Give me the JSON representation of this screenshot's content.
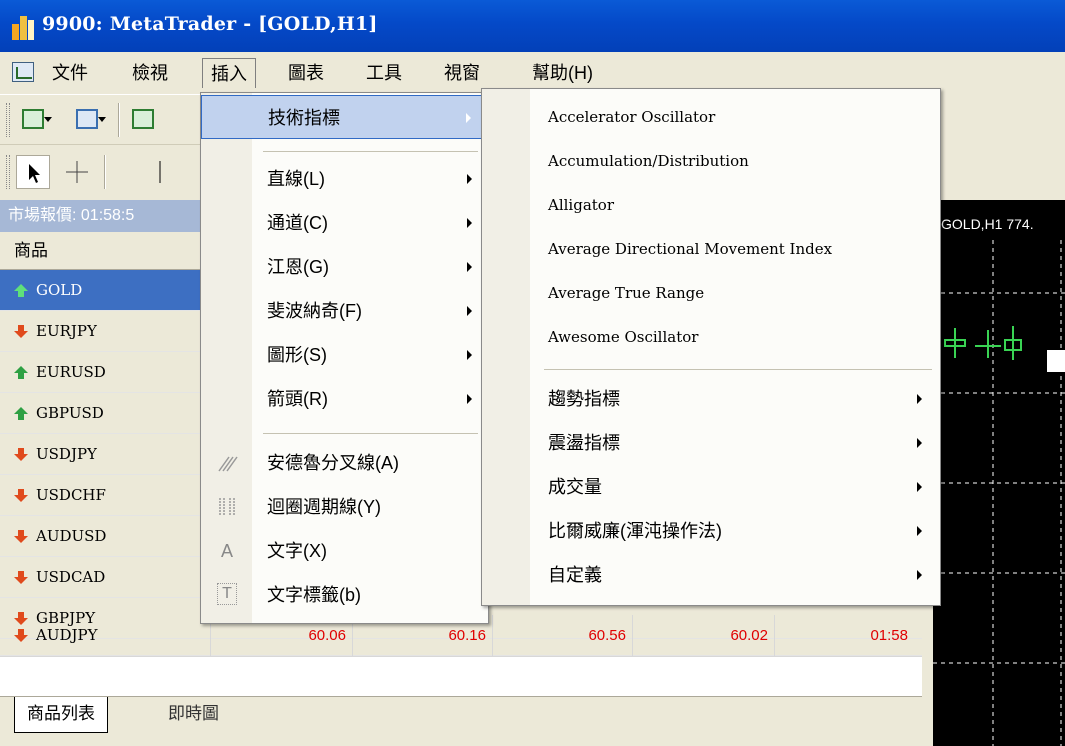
{
  "window": {
    "title": "9900: MetaTrader - [GOLD,H1]"
  },
  "menubar": {
    "items": [
      "文件",
      "檢視",
      "插入",
      "圖表",
      "工具",
      "視窗",
      "幫助(H)"
    ]
  },
  "market_watch": {
    "header": "市場報價: 01:58:5",
    "column_header": "商品",
    "rows": [
      {
        "symbol": "GOLD",
        "direction": "up"
      },
      {
        "symbol": "EURJPY",
        "direction": "down"
      },
      {
        "symbol": "EURUSD",
        "direction": "up"
      },
      {
        "symbol": "GBPUSD",
        "direction": "up"
      },
      {
        "symbol": "USDJPY",
        "direction": "down"
      },
      {
        "symbol": "USDCHF",
        "direction": "down"
      },
      {
        "symbol": "AUDUSD",
        "direction": "down"
      },
      {
        "symbol": "USDCAD",
        "direction": "down"
      },
      {
        "symbol": "GBPJPY",
        "direction": "down"
      },
      {
        "symbol": "AUDJPY",
        "direction": "down"
      }
    ],
    "last_row_values": [
      "60.06",
      "60.16",
      "60.56",
      "60.02",
      "01:58"
    ],
    "tabs": [
      "商品列表",
      "即時圖"
    ]
  },
  "chart": {
    "title": "GOLD,H1 774."
  },
  "insert_menu": {
    "items": [
      {
        "label": "技術指標",
        "submenu": true,
        "highlighted": true
      },
      {
        "label": "直線(L)",
        "submenu": true
      },
      {
        "label": "通道(C)",
        "submenu": true
      },
      {
        "label": "江恩(G)",
        "submenu": true
      },
      {
        "label": "斐波納奇(F)",
        "submenu": true
      },
      {
        "label": "圖形(S)",
        "submenu": true
      },
      {
        "label": "箭頭(R)",
        "submenu": true
      },
      {
        "label": "安德魯分叉線(A)",
        "icon": "andrews-pitchfork-icon"
      },
      {
        "label": "迴圈週期線(Y)",
        "icon": "cycle-lines-icon"
      },
      {
        "label": "文字(X)",
        "icon": "text-icon",
        "glyph": "A"
      },
      {
        "label": "文字標籤(b)",
        "icon": "text-label-icon",
        "glyph": "T"
      }
    ]
  },
  "indicators_submenu": {
    "items": [
      {
        "label": "Accelerator Oscillator"
      },
      {
        "label": "Accumulation/Distribution"
      },
      {
        "label": "Alligator"
      },
      {
        "label": "Average Directional Movement Index"
      },
      {
        "label": "Average True Range"
      },
      {
        "label": "Awesome Oscillator"
      },
      {
        "label": "趨勢指標",
        "submenu": true
      },
      {
        "label": "震盪指標",
        "submenu": true
      },
      {
        "label": "成交量",
        "submenu": true
      },
      {
        "label": "比爾威廉(渾沌操作法)",
        "submenu": true
      },
      {
        "label": "自定義",
        "submenu": true
      }
    ]
  },
  "colors": {
    "titlebar": "#0449c8",
    "highlight": "#c1d2ee",
    "selected_row": "#3d6fc2",
    "price_red": "#e00000"
  }
}
